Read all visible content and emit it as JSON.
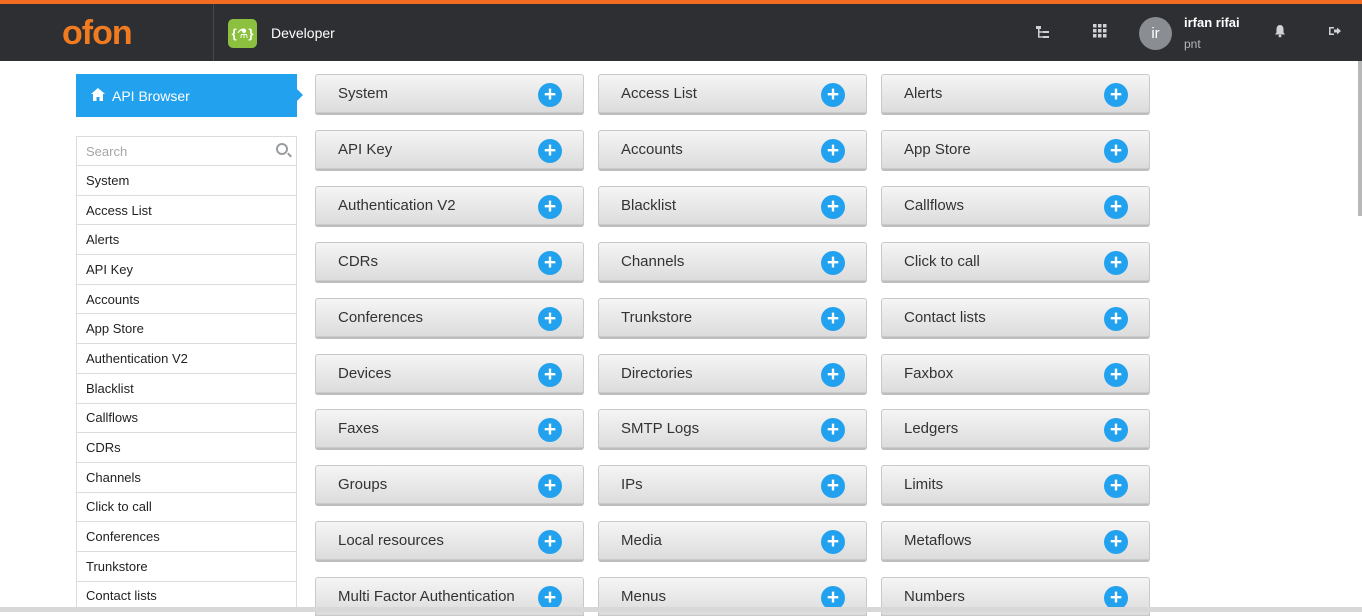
{
  "header": {
    "logo": "ofon",
    "app_icon_text": "{⚗}",
    "app_name": "Developer",
    "user": {
      "initials": "ir",
      "name": "irfan rifai",
      "org": "pnt"
    },
    "icons": [
      "tree-icon",
      "apps-grid-icon",
      "bell-icon",
      "logout-icon"
    ]
  },
  "sidebar": {
    "tab_label": "API Browser",
    "search_placeholder": "Search",
    "items": [
      "System",
      "Access List",
      "Alerts",
      "API Key",
      "Accounts",
      "App Store",
      "Authentication V2",
      "Blacklist",
      "Callflows",
      "CDRs",
      "Channels",
      "Click to call",
      "Conferences",
      "Trunkstore",
      "Contact lists"
    ]
  },
  "api_cards": [
    "System",
    "Access List",
    "Alerts",
    "API Key",
    "Accounts",
    "App Store",
    "Authentication V2",
    "Blacklist",
    "Callflows",
    "CDRs",
    "Channels",
    "Click to call",
    "Conferences",
    "Trunkstore",
    "Contact lists",
    "Devices",
    "Directories",
    "Faxbox",
    "Faxes",
    "SMTP Logs",
    "Ledgers",
    "Groups",
    "IPs",
    "Limits",
    "Local resources",
    "Media",
    "Metaflows",
    "Multi Factor Authentication",
    "Menus",
    "Numbers"
  ],
  "colors": {
    "accent": "#22a2ee",
    "header_bg": "#2d2f33",
    "brand": "#f27b20",
    "app_icon": "#8cc13f"
  }
}
